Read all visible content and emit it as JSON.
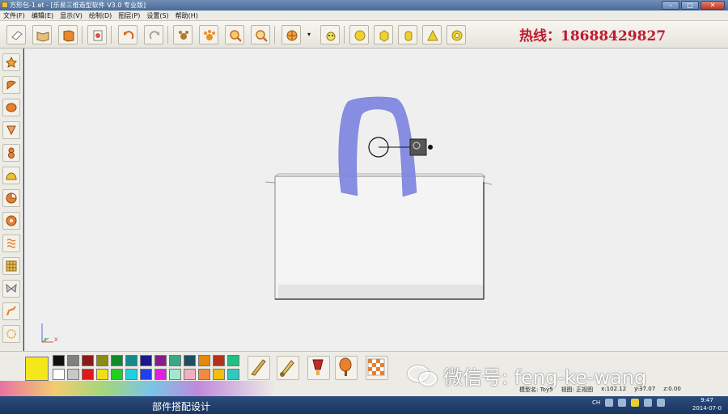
{
  "window": {
    "title": "方形包-1.et - [乐易三维造型软件 V3.0 专业版]",
    "buttons": {
      "minimize": "–",
      "maximize": "□",
      "close": "✕"
    }
  },
  "menu": [
    "文件(F)",
    "编辑(E)",
    "显示(V)",
    "绘制(D)",
    "图层(P)",
    "设置(S)",
    "帮助(H)"
  ],
  "hotline": "热线：18688429827",
  "axis": {
    "x": "x",
    "z": "z"
  },
  "watermark": "微信号: feng-ke-wang",
  "status": {
    "model_name": "模型名: Toy5",
    "view": "视图: 正视图",
    "x": "x:102.12",
    "y": "y:37.07",
    "z": "z:0.00"
  },
  "caption": "部件搭配设计",
  "taskbar": {
    "lang": "CH",
    "time": "9:47",
    "date": "2014-07-0"
  },
  "colors": {
    "canvas": "#efefef",
    "handle": "#7f86e0",
    "hotline": "#c01a2e",
    "active_swatch": "#f5e81a"
  },
  "palette_top": [
    "#101010",
    "#808080",
    "#8b1a1a",
    "#8b8b10",
    "#138a2a",
    "#148a8a",
    "#1a1a8b",
    "#8a1a8a",
    "#3aa888",
    "#1f4e60",
    "#e08a10",
    "#b2331a",
    "#20c080"
  ],
  "palette_bottom": [
    "#ffffff",
    "#c8c8c8",
    "#e01a1a",
    "#f0e010",
    "#20d020",
    "#20d0e0",
    "#2040f0",
    "#e020e0",
    "#a0e8d0",
    "#f0b0c0",
    "#f08a40",
    "#f0c010",
    "#30c8c0"
  ]
}
